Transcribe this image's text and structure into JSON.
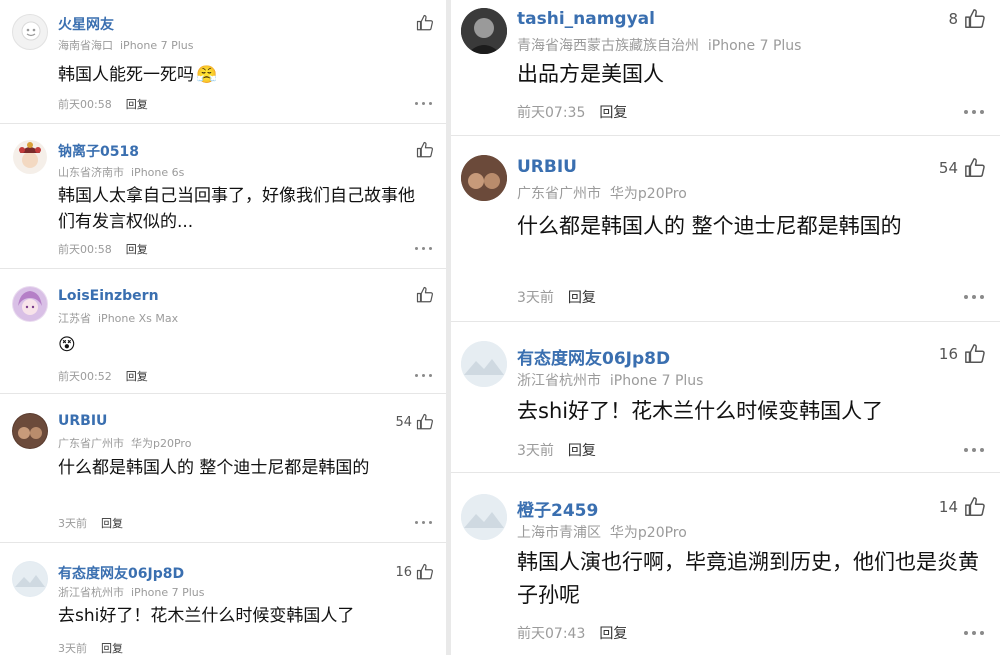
{
  "left": [
    {
      "name": "火星网友",
      "location": "海南省海口",
      "device": "iPhone 7 Plus",
      "text": "韩国人能死一死吗",
      "time": "前天00:58",
      "reply": "回复",
      "likes": "",
      "avatar_color": "#f3f3f3",
      "emoji": "😤"
    },
    {
      "name": "钠离子0518",
      "location": "山东省济南市",
      "device": "iPhone 6s",
      "text": "韩国人太拿自己当回事了，好像我们自己故事他们有发言权似的...",
      "time": "前天00:58",
      "reply": "回复",
      "likes": "",
      "avatar_color": "#c8a07a"
    },
    {
      "name": "LoisEinzbern",
      "location": "江苏省",
      "device": "iPhone Xs Max",
      "text": "",
      "time": "前天00:52",
      "reply": "回复",
      "likes": "",
      "avatar_color": "#c9a6d6",
      "emoji": "😵"
    },
    {
      "name": "URBIU",
      "location": "广东省广州市",
      "device": "华为p20Pro",
      "text": "什么都是韩国人的 整个迪士尼都是韩国的",
      "time": "3天前",
      "reply": "回复",
      "likes": "54",
      "avatar_color": "#6b4a3a"
    },
    {
      "name": "有态度网友06Jp8D",
      "location": "浙江省杭州市",
      "device": "iPhone 7 Plus",
      "text": "去shi好了！花木兰什么时候变韩国人了",
      "time": "3天前",
      "reply": "回复",
      "likes": "16",
      "avatar_color": "#dfe7ee"
    }
  ],
  "right": [
    {
      "name": "tashi_namgyal",
      "location": "青海省海西蒙古族藏族自治州",
      "device": "iPhone 7 Plus",
      "text": "出品方是美国人",
      "time": "前天07:35",
      "reply": "回复",
      "likes": "8",
      "avatar_color": "#2b2b2b"
    },
    {
      "name": "URBIU",
      "location": "广东省广州市",
      "device": "华为p20Pro",
      "text": "什么都是韩国人的 整个迪士尼都是韩国的",
      "time": "3天前",
      "reply": "回复",
      "likes": "54",
      "avatar_color": "#6b4a3a"
    },
    {
      "name": "有态度网友06Jp8D",
      "location": "浙江省杭州市",
      "device": "iPhone 7 Plus",
      "text": "去shi好了！花木兰什么时候变韩国人了",
      "time": "3天前",
      "reply": "回复",
      "likes": "16",
      "avatar_color": "#dfe7ee"
    },
    {
      "name": "橙子2459",
      "location": "上海市青浦区",
      "device": "华为p20Pro",
      "text": "韩国人演也行啊，毕竟追溯到历史，他们也是炎黄子孙呢",
      "time": "前天07:43",
      "reply": "回复",
      "likes": "14",
      "avatar_color": "#dfe7ee"
    }
  ]
}
